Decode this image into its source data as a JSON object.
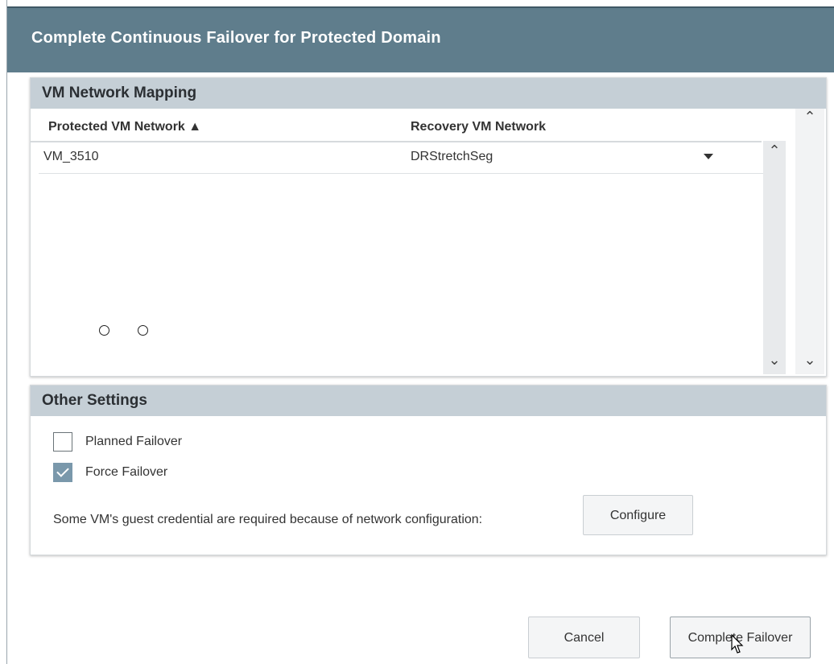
{
  "dialog": {
    "title": "Complete Continuous Failover for Protected Domain"
  },
  "vm_network_mapping": {
    "header": "VM Network Mapping",
    "columns": {
      "protected": "Protected VM Network ▲",
      "recovery": "Recovery VM Network"
    },
    "rows": [
      {
        "protected": "VM_3510",
        "recovery": "DRStretchSeg"
      }
    ]
  },
  "other_settings": {
    "header": "Other Settings",
    "planned_failover": {
      "label": "Planned Failover",
      "checked": false
    },
    "force_failover": {
      "label": "Force Failover",
      "checked": true
    },
    "credential_message": "Some VM's guest credential are required because of network configuration:",
    "configure_label": "Configure"
  },
  "footer": {
    "cancel_label": "Cancel",
    "complete_label": "Complete Failover"
  },
  "icons": {
    "scroll_up": "chevron-up-icon",
    "scroll_down": "chevron-down-icon",
    "dropdown": "caret-down-icon",
    "cursor": "pointer-cursor-icon"
  },
  "colors": {
    "titlebar": "#5f7d8c",
    "panel_header": "#c5cfd6",
    "checkbox_checked": "#7a98ab"
  }
}
